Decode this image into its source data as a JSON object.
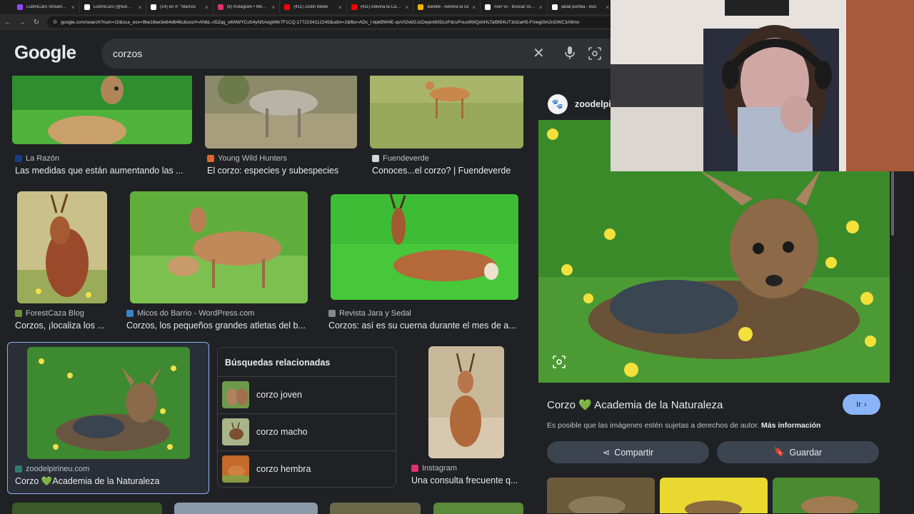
{
  "browser": {
    "tabs": [
      {
        "label": "LudmiCaro Stream - V",
        "color": "#9146ff"
      },
      {
        "label": "LudmiCaro (@ludmica",
        "color": "#ffffff"
      },
      {
        "label": "(14) en X: \"Marcos",
        "color": "#ffffff"
      },
      {
        "label": "(8) Instagram • Mensa",
        "color": "#e1306c"
      },
      {
        "label": "(411) Justin Biebe",
        "color": "#ff0000"
      },
      {
        "label": "(411) Adivina la Canción",
        "color": "#ff0000"
      },
      {
        "label": "Bandle - Adivina la ca",
        "color": "#f4b400"
      },
      {
        "label": "river vs - Buscar con G",
        "color": "#ffffff"
      },
      {
        "label": "jabali pumba - Bus",
        "color": "#ffffff"
      }
    ],
    "url": "google.com/search?num=10&sca_esv=9be18ee3e64d646c&sxsrf=ANbL-n5Zqq_e6NWYCo54yNSAxgW6r7F1CQ:1772154112245&udm=2&fbs=ADc_l-bpkBW4E-qsVIOvbGJcDwpnI60DczFdcvPnuv8WQohHLTaf9I54U71bi2aH5-Fmeg0IA2nDWC3A9mn"
  },
  "search": {
    "logo": "Google",
    "query": "corzos"
  },
  "results": [
    {
      "source": "La Razón",
      "title": "Las medidas que están aumentando las ...",
      "src_color": "#1a3a8a"
    },
    {
      "source": "Young Wild Hunters",
      "title": "El corzo: especies y subespecies",
      "src_color": "#e0662b"
    },
    {
      "source": "Fuendeverde",
      "title": "Conoces...el corzo? | Fuendeverde",
      "src_color": "#cfd8dc"
    },
    {
      "source": "ForestCaza Blog",
      "title": "Corzos, ¡localiza los ...",
      "src_color": "#6d8f3a"
    },
    {
      "source": "Micos do Barrio - WordPress.com",
      "title": "Corzos, los pequeños grandes atletas del b...",
      "src_color": "#3b82c4"
    },
    {
      "source": "Revista Jara y Sedal",
      "title": "Corzos: así es su cuerna durante el mes de a...",
      "src_color": "#888888"
    },
    {
      "source": "zoodelpirineu.com",
      "title": "Corzo 💚Academia de la Naturaleza",
      "src_color": "#2e7d6a"
    },
    {
      "source": "Instagram",
      "title": "Una consulta frecuente q...",
      "src_color": "#e1306c"
    }
  ],
  "related": {
    "heading": "Búsquedas relacionadas",
    "items": [
      "corzo joven",
      "corzo macho",
      "corzo hembra"
    ]
  },
  "panel": {
    "site": "zoodelpi",
    "title": "Corzo 💚 Academia de la Naturaleza",
    "visit_label": "Ir",
    "copyright_note": "Es posible que las imágenes estén sujetas a derechos de autor.",
    "more_info": "Más información",
    "share_label": "Compartir",
    "save_label": "Guardar"
  }
}
